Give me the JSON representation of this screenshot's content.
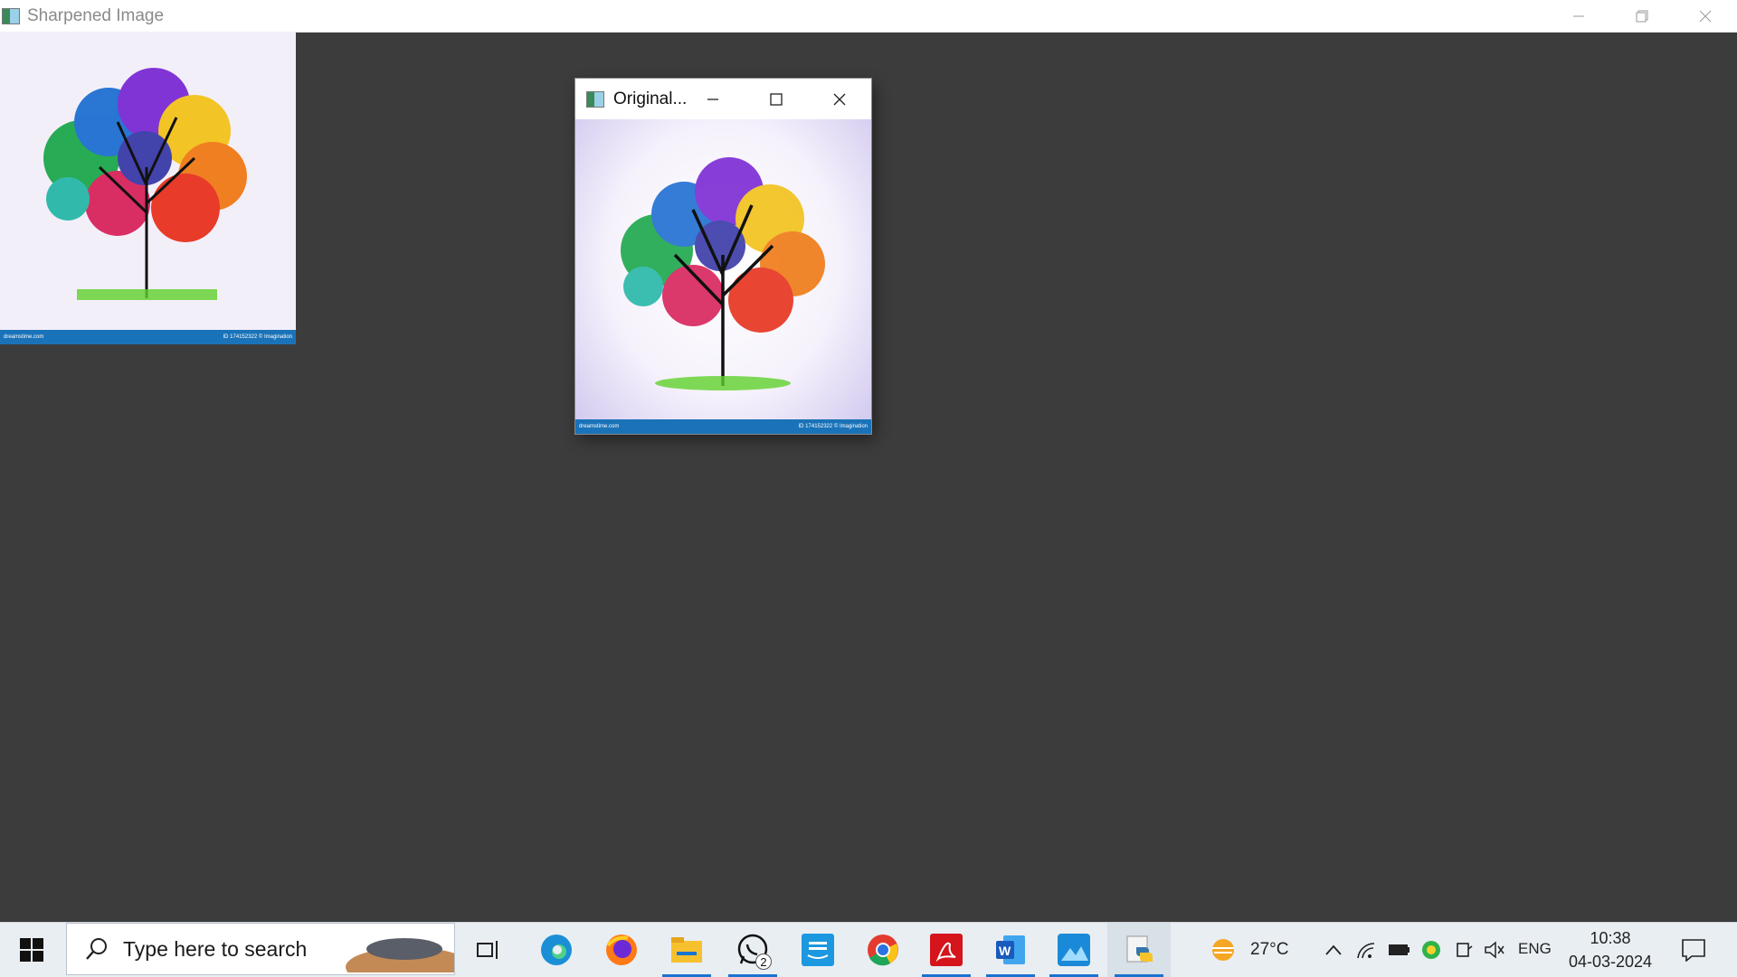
{
  "main_window": {
    "title": "Sharpened Image",
    "image_footer_left": "dreamstime.com",
    "image_footer_right": "ID 174152322 © Imagination"
  },
  "original_window": {
    "title": "Original...",
    "image_footer_left": "dreamstime.com",
    "image_footer_right": "ID 174152322 © Imagination"
  },
  "taskbar": {
    "search_placeholder": "Type here to search",
    "whatsapp_badge": "2",
    "weather": "27°C",
    "language": "ENG",
    "time": "10:38",
    "date": "04-03-2024"
  },
  "colors": {
    "desktop_bg": "#3c3c3c",
    "taskbar_bg": "#e9eef3",
    "accent": "#1a73d0",
    "image_footer": "#1a73b8"
  },
  "icons": [
    "windows-start-icon",
    "search-icon",
    "task-view-icon",
    "edge-icon",
    "firefox-icon",
    "file-explorer-icon",
    "whatsapp-icon",
    "prime-video-icon",
    "chrome-icon",
    "acrobat-icon",
    "word-icon",
    "photos-icon",
    "python-icon",
    "weather-icon",
    "chevron-up-icon",
    "network-icon",
    "battery-icon",
    "app-tray-icon",
    "meet-icon",
    "volume-muted-icon",
    "notification-icon"
  ]
}
